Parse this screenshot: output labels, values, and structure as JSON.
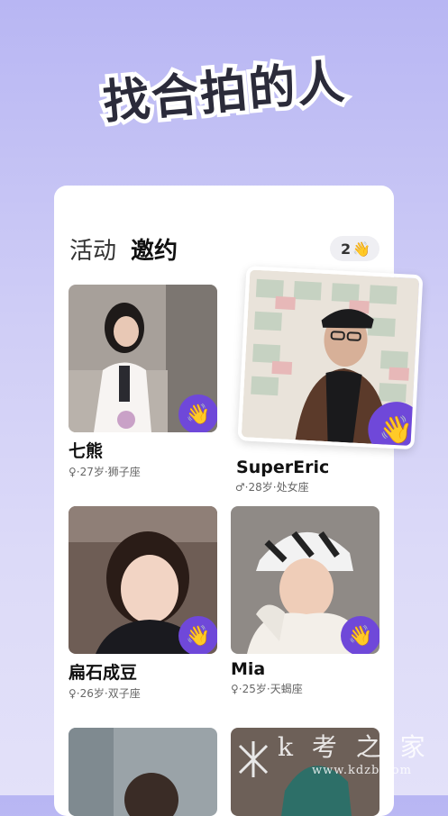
{
  "headline": "找合拍的人",
  "tabs": [
    {
      "label": "活动",
      "active": false
    },
    {
      "label": "邀约",
      "active": true
    }
  ],
  "wave_count": {
    "count": "2",
    "icon": "wave-hand-icon"
  },
  "profiles": [
    {
      "name": "七熊",
      "meta": "♀·27岁·狮子座"
    },
    {
      "name": "SuperEric",
      "meta": "♂·28岁·处女座"
    },
    {
      "name": "扁石成豆",
      "meta": "♀·26岁·双子座"
    },
    {
      "name": "Mia",
      "meta": "♀·25岁·天蝎座"
    }
  ],
  "watermark": "k 考 之 家",
  "watermark_url": "www.kdzb.com",
  "colors": {
    "accent": "#6f48d9",
    "wave": "#f5c34c",
    "background_top": "#b8b6f3"
  }
}
